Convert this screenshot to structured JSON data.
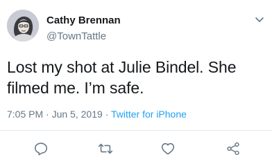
{
  "user": {
    "display_name": "Cathy Brennan",
    "handle": "@TownTattle"
  },
  "tweet": {
    "text": "Lost my shot at Julie Bindel. She filmed me. I’m safe.",
    "time": "7:05 PM",
    "separator": " · ",
    "date": "Jun 5, 2019",
    "source": "Twitter for iPhone"
  },
  "icons": {
    "reply": "reply-icon",
    "retweet": "retweet-icon",
    "like": "heart-icon",
    "share": "share-icon",
    "menu": "chevron-down-icon"
  },
  "colors": {
    "text": "#14171a",
    "secondary": "#657786",
    "link": "#1da1f2",
    "icon": "#657786",
    "divider": "#e6ecf0"
  }
}
